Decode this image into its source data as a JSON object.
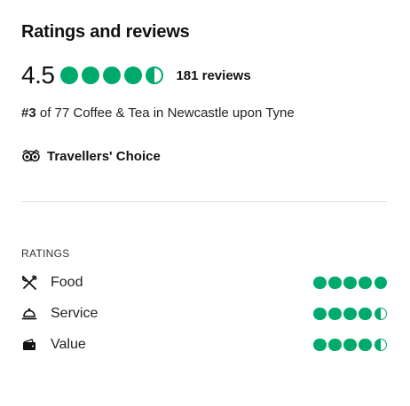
{
  "header": {
    "title": "Ratings and reviews"
  },
  "overall": {
    "score": "4.5",
    "bubbles": 4.5,
    "reviews": "181 reviews"
  },
  "ranking": {
    "rank": "#3",
    "rest": " of 77 Coffee & Tea in Newcastle upon Tyne"
  },
  "award": {
    "label": "Travellers' Choice",
    "icon": "owl-icon"
  },
  "ratings_section": {
    "heading": "RATINGS",
    "items": [
      {
        "label": "Food",
        "icon": "utensils-icon",
        "bubbles": 5
      },
      {
        "label": "Service",
        "icon": "bell-icon",
        "bubbles": 4.5
      },
      {
        "label": "Value",
        "icon": "wallet-icon",
        "bubbles": 4.5
      }
    ]
  },
  "colors": {
    "bubble_green": "#00aa6c",
    "divider": "#e0e0e0"
  }
}
